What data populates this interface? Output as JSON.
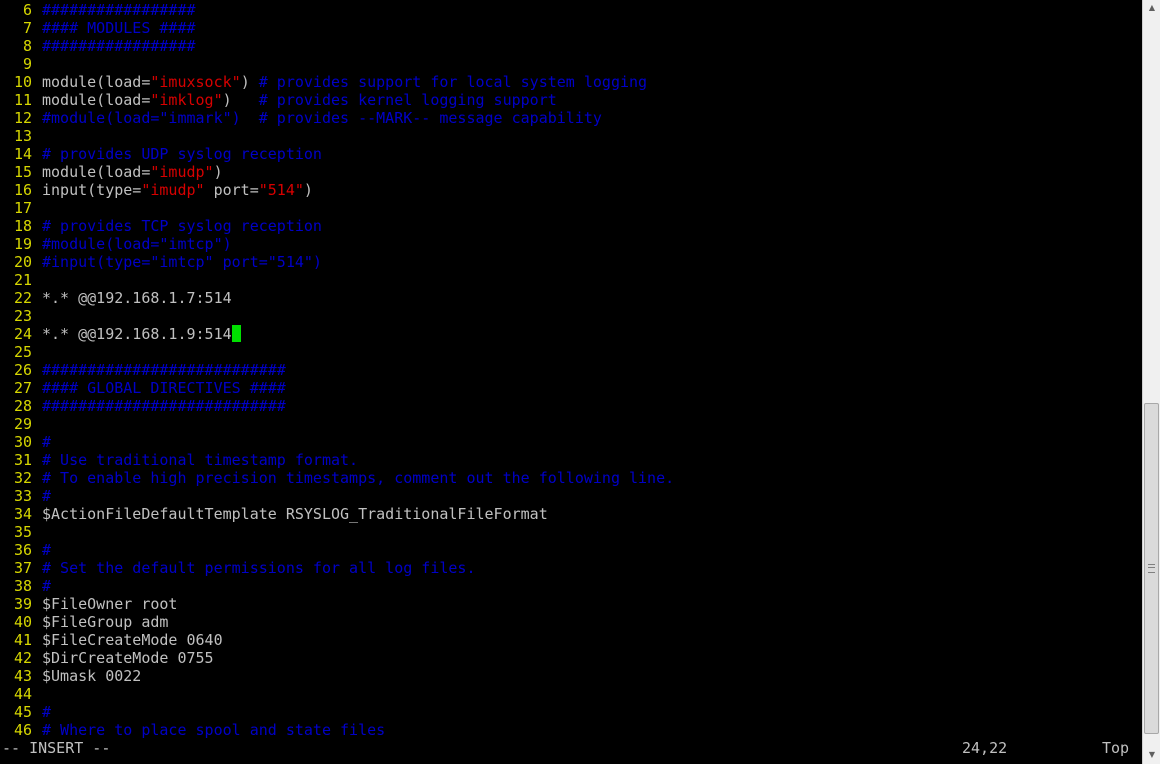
{
  "editor": {
    "colors": {
      "background": "#000000",
      "line_number": "#d7d700",
      "comment": "#0000c8",
      "string": "#d70000",
      "normal": "#c0c0c0",
      "cursor": "#00e000"
    },
    "lines": [
      {
        "n": "6",
        "tokens": [
          {
            "t": "#################",
            "c": "comment"
          }
        ]
      },
      {
        "n": "7",
        "tokens": [
          {
            "t": "#### MODULES ####",
            "c": "comment"
          }
        ]
      },
      {
        "n": "8",
        "tokens": [
          {
            "t": "#################",
            "c": "comment"
          }
        ]
      },
      {
        "n": "9",
        "tokens": []
      },
      {
        "n": "10",
        "tokens": [
          {
            "t": "module(load=",
            "c": "normal"
          },
          {
            "t": "\"imuxsock\"",
            "c": "string"
          },
          {
            "t": ") ",
            "c": "normal"
          },
          {
            "t": "# provides support for local system logging",
            "c": "comment"
          }
        ]
      },
      {
        "n": "11",
        "tokens": [
          {
            "t": "module(load=",
            "c": "normal"
          },
          {
            "t": "\"imklog\"",
            "c": "string"
          },
          {
            "t": ")   ",
            "c": "normal"
          },
          {
            "t": "# provides kernel logging support",
            "c": "comment"
          }
        ]
      },
      {
        "n": "12",
        "tokens": [
          {
            "t": "#module(load=\"immark\")  # provides --MARK-- message capability",
            "c": "comment"
          }
        ]
      },
      {
        "n": "13",
        "tokens": []
      },
      {
        "n": "14",
        "tokens": [
          {
            "t": "# provides UDP syslog reception",
            "c": "comment"
          }
        ]
      },
      {
        "n": "15",
        "tokens": [
          {
            "t": "module(load=",
            "c": "normal"
          },
          {
            "t": "\"imudp\"",
            "c": "string"
          },
          {
            "t": ")",
            "c": "normal"
          }
        ]
      },
      {
        "n": "16",
        "tokens": [
          {
            "t": "input(type=",
            "c": "normal"
          },
          {
            "t": "\"imudp\"",
            "c": "string"
          },
          {
            "t": " port=",
            "c": "normal"
          },
          {
            "t": "\"514\"",
            "c": "string"
          },
          {
            "t": ")",
            "c": "normal"
          }
        ]
      },
      {
        "n": "17",
        "tokens": []
      },
      {
        "n": "18",
        "tokens": [
          {
            "t": "# provides TCP syslog reception",
            "c": "comment"
          }
        ]
      },
      {
        "n": "19",
        "tokens": [
          {
            "t": "#module(load=\"imtcp\")",
            "c": "comment"
          }
        ]
      },
      {
        "n": "20",
        "tokens": [
          {
            "t": "#input(type=\"imtcp\" port=\"514\")",
            "c": "comment"
          }
        ]
      },
      {
        "n": "21",
        "tokens": []
      },
      {
        "n": "22",
        "tokens": [
          {
            "t": "*.* @@192.168.1.7:514",
            "c": "normal"
          }
        ]
      },
      {
        "n": "23",
        "tokens": []
      },
      {
        "n": "24",
        "tokens": [
          {
            "t": "*.* @@192.168.1.9:514",
            "c": "normal"
          }
        ],
        "cursor": true
      },
      {
        "n": "25",
        "tokens": []
      },
      {
        "n": "26",
        "tokens": [
          {
            "t": "###########################",
            "c": "comment"
          }
        ]
      },
      {
        "n": "27",
        "tokens": [
          {
            "t": "#### GLOBAL DIRECTIVES ####",
            "c": "comment"
          }
        ]
      },
      {
        "n": "28",
        "tokens": [
          {
            "t": "###########################",
            "c": "comment"
          }
        ]
      },
      {
        "n": "29",
        "tokens": []
      },
      {
        "n": "30",
        "tokens": [
          {
            "t": "#",
            "c": "comment"
          }
        ]
      },
      {
        "n": "31",
        "tokens": [
          {
            "t": "# Use traditional timestamp format.",
            "c": "comment"
          }
        ]
      },
      {
        "n": "32",
        "tokens": [
          {
            "t": "# To enable high precision timestamps, comment out the following line.",
            "c": "comment"
          }
        ]
      },
      {
        "n": "33",
        "tokens": [
          {
            "t": "#",
            "c": "comment"
          }
        ]
      },
      {
        "n": "34",
        "tokens": [
          {
            "t": "$ActionFileDefaultTemplate RSYSLOG_TraditionalFileFormat",
            "c": "normal"
          }
        ]
      },
      {
        "n": "35",
        "tokens": []
      },
      {
        "n": "36",
        "tokens": [
          {
            "t": "#",
            "c": "comment"
          }
        ]
      },
      {
        "n": "37",
        "tokens": [
          {
            "t": "# Set the default permissions for all log files.",
            "c": "comment"
          }
        ]
      },
      {
        "n": "38",
        "tokens": [
          {
            "t": "#",
            "c": "comment"
          }
        ]
      },
      {
        "n": "39",
        "tokens": [
          {
            "t": "$FileOwner root",
            "c": "normal"
          }
        ]
      },
      {
        "n": "40",
        "tokens": [
          {
            "t": "$FileGroup adm",
            "c": "normal"
          }
        ]
      },
      {
        "n": "41",
        "tokens": [
          {
            "t": "$FileCreateMode 0640",
            "c": "normal"
          }
        ]
      },
      {
        "n": "42",
        "tokens": [
          {
            "t": "$DirCreateMode 0755",
            "c": "normal"
          }
        ]
      },
      {
        "n": "43",
        "tokens": [
          {
            "t": "$Umask 0022",
            "c": "normal"
          }
        ]
      },
      {
        "n": "44",
        "tokens": []
      },
      {
        "n": "45",
        "tokens": [
          {
            "t": "#",
            "c": "comment"
          }
        ]
      },
      {
        "n": "46",
        "tokens": [
          {
            "t": "# Where to place spool and state files",
            "c": "comment"
          }
        ]
      }
    ]
  },
  "status": {
    "mode": "-- INSERT --",
    "position": "24,22",
    "scroll": "Top"
  },
  "scrollbar": {
    "position_fraction": 0.53
  }
}
